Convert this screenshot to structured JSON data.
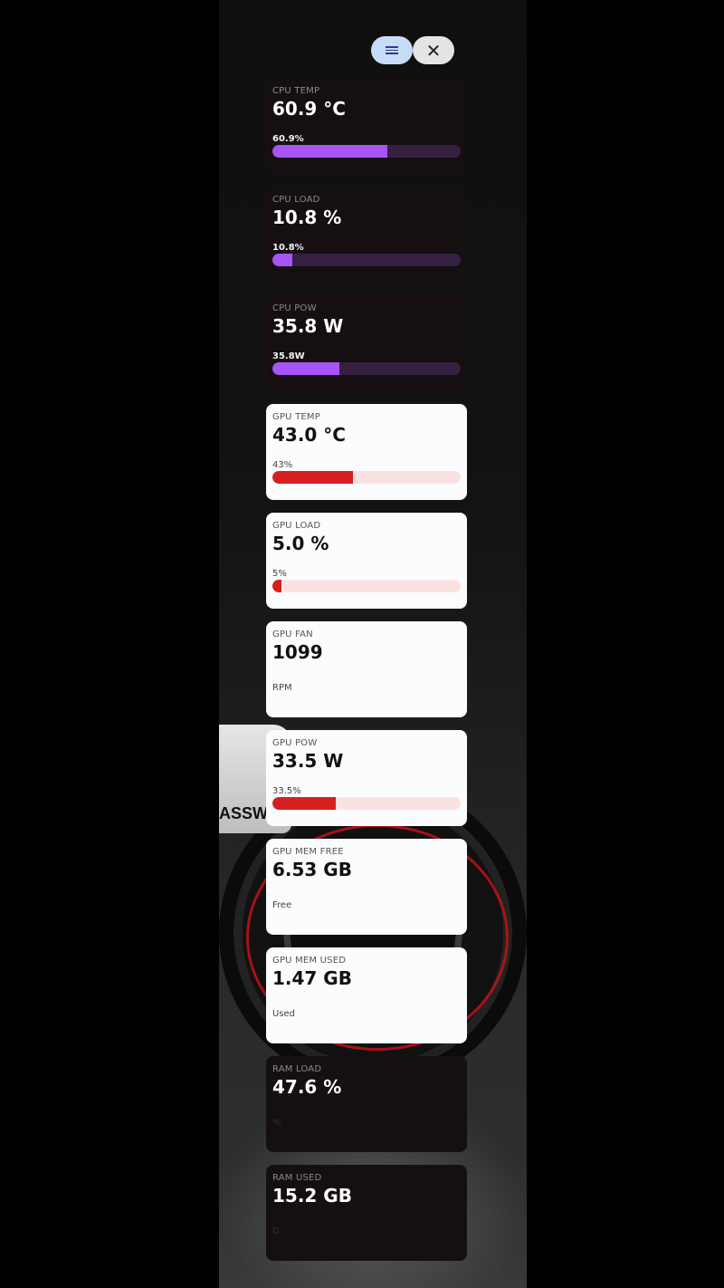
{
  "toolbar": {
    "menu_icon": "menu-icon",
    "close_icon": "close-icon",
    "close_glyph": "✕"
  },
  "background": {
    "car_text": "ASSW"
  },
  "cards": [
    {
      "label": "CPU TEMP",
      "value": "60.9 °C",
      "sub": "60.9%",
      "percent": 60.9,
      "theme": "dark"
    },
    {
      "label": "CPU LOAD",
      "value": "10.8 %",
      "sub": "10.8%",
      "percent": 10.8,
      "theme": "dark"
    },
    {
      "label": "CPU POW",
      "value": "35.8 W",
      "sub": "35.8W",
      "percent": 35.8,
      "theme": "dark"
    },
    {
      "label": "GPU TEMP",
      "value": "43.0 °C",
      "sub": "43%",
      "percent": 43,
      "theme": "light"
    },
    {
      "label": "GPU LOAD",
      "value": "5.0 %",
      "sub": "5%",
      "percent": 5,
      "theme": "light"
    },
    {
      "label": "GPU FAN",
      "value": "1099",
      "sub": "RPM",
      "theme": "light"
    },
    {
      "label": "GPU POW",
      "value": "33.5 W",
      "sub": "33.5%",
      "percent": 33.5,
      "theme": "light"
    },
    {
      "label": "GPU MEM FREE",
      "value": "6.53 GB",
      "sub": "Free",
      "theme": "light"
    },
    {
      "label": "GPU MEM USED",
      "value": "1.47 GB",
      "sub": "Used",
      "theme": "light"
    },
    {
      "label": "RAM LOAD",
      "value": "47.6 %",
      "sub": "%",
      "theme": "dark"
    },
    {
      "label": "RAM USED",
      "value": "15.2 GB",
      "sub": "G",
      "theme": "dark"
    }
  ]
}
